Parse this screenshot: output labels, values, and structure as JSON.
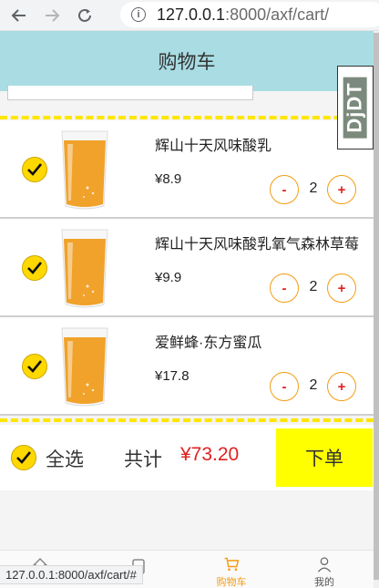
{
  "browser": {
    "url_host": "127.0.0.1",
    "url_rest": ":8000/axf/cart/",
    "status_url": "127.0.0.1:8000/axf/cart/#"
  },
  "header": {
    "title": "购物车"
  },
  "items": [
    {
      "name": "辉山十天风味酸乳",
      "price": "¥8.9",
      "qty": "2",
      "minus": "-",
      "plus": "+"
    },
    {
      "name": "辉山十天风味酸乳氧气森林草莓",
      "price": "¥9.9",
      "qty": "2",
      "minus": "-",
      "plus": "+"
    },
    {
      "name": "爱鲜蜂·东方蜜瓜",
      "price": "¥17.8",
      "qty": "2",
      "minus": "-",
      "plus": "+"
    }
  ],
  "footer": {
    "select_all": "全选",
    "total_label": "共计",
    "total_value": "¥73.20",
    "order_button": "下单"
  },
  "tabs": [
    {
      "label": "",
      "icon": "home-icon"
    },
    {
      "label": "",
      "icon": "market-icon"
    },
    {
      "label": "购物车",
      "icon": "cart-icon",
      "active": true
    },
    {
      "label": "我的",
      "icon": "user-icon"
    }
  ],
  "djdt": {
    "label": "DjDT"
  },
  "colors": {
    "header_bg": "#a9dce3",
    "accent_yellow": "#ffe600",
    "order_button_bg": "#ffff00",
    "price_red": "#e02020",
    "qty_border": "#f39c12"
  }
}
